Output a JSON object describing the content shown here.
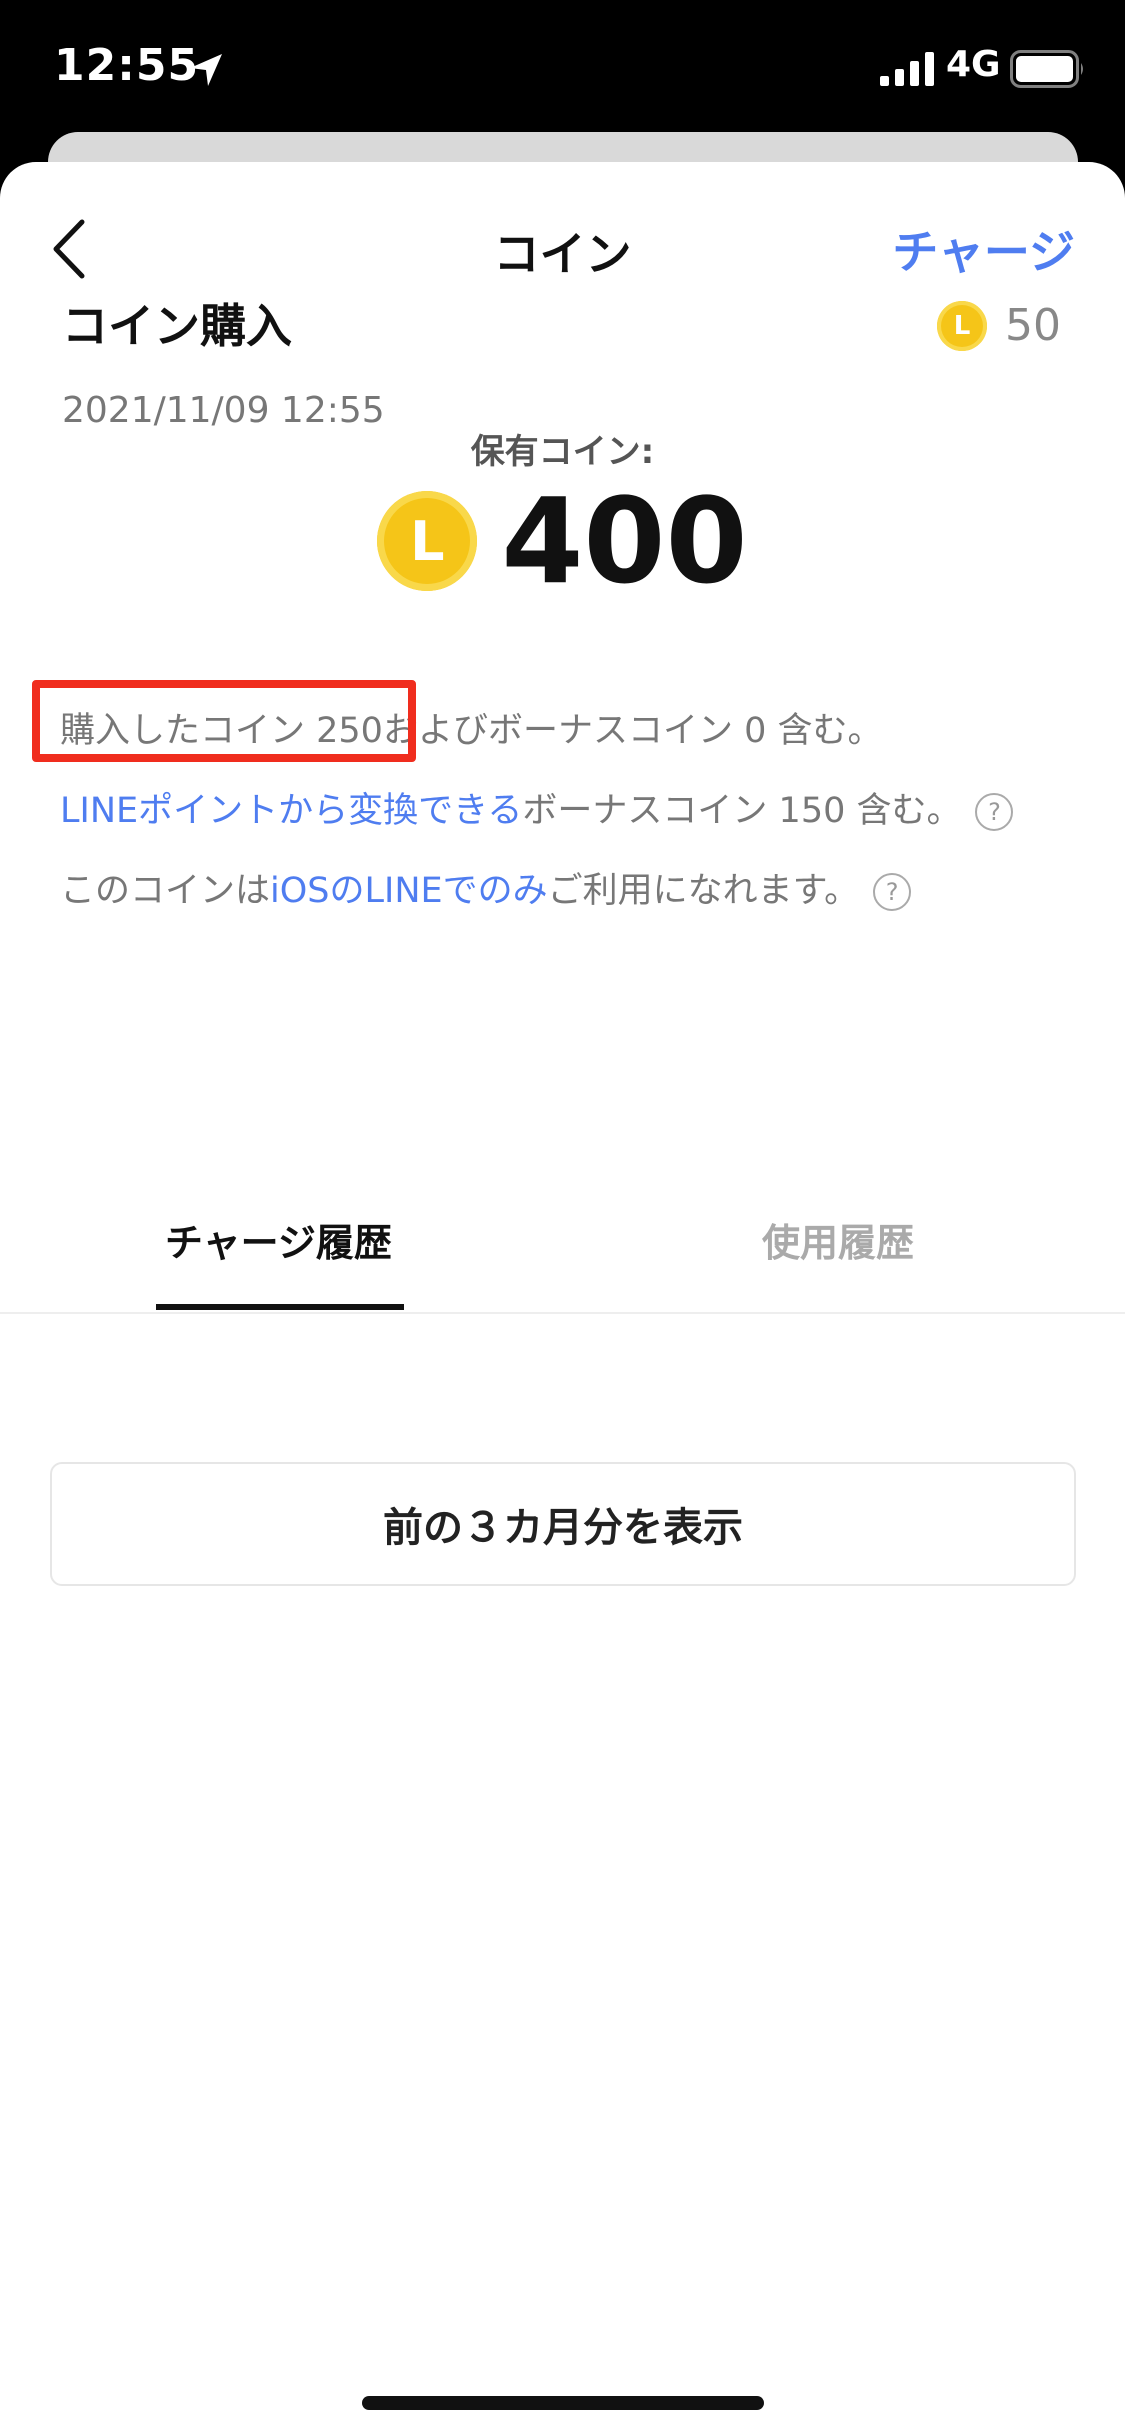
{
  "status_bar": {
    "time": "12:55",
    "network": "4G"
  },
  "nav": {
    "title": "コイン",
    "charge_label": "チャージ"
  },
  "balance": {
    "label": "保有コイン:",
    "coin_symbol": "L",
    "value": "400"
  },
  "info": {
    "line1_highlight": "購入したコイン 250",
    "line1_rest": "およびボーナスコイン 0 含む。",
    "line2_link": "LINEポイントから変換できる",
    "line2_rest": "ボーナスコイン 150 含む。",
    "line3_prefix": "このコインは",
    "line3_link": "iOSのLINEでのみ",
    "line3_rest": "ご利用になれます。",
    "help_symbol": "?"
  },
  "tabs": [
    {
      "label": "チャージ履歴",
      "active": true
    },
    {
      "label": "使用履歴",
      "active": false
    }
  ],
  "history": [
    {
      "title": "コイン購入",
      "date": "2021/11/09 12:55",
      "coin_symbol": "L",
      "amount": "50"
    }
  ],
  "more_button_label": "前の３カ月分を表示",
  "colors": {
    "accent": "#4f7df0",
    "coin": "#f5c518",
    "highlight": "#f02d1e"
  }
}
